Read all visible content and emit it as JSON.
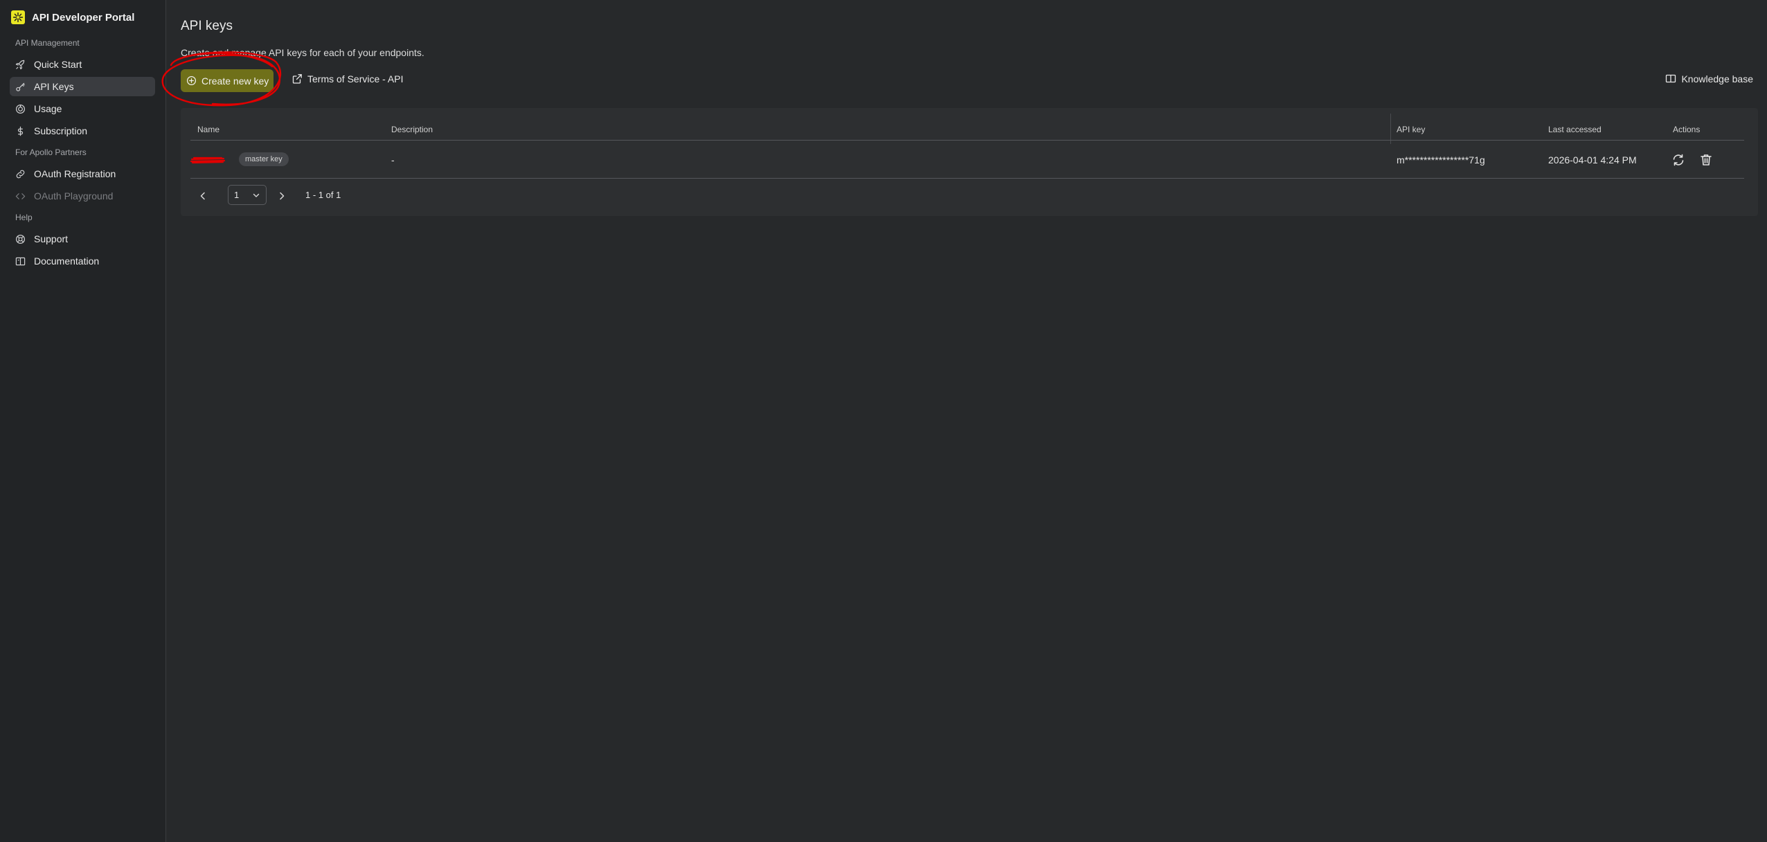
{
  "sidebar": {
    "brand_title": "API Developer Portal",
    "sections": [
      {
        "label": "API Management"
      },
      {
        "label": "For Apollo Partners"
      },
      {
        "label": "Help"
      }
    ],
    "items": [
      {
        "label": "Quick Start",
        "icon": "rocket-icon"
      },
      {
        "label": "API Keys",
        "icon": "key-icon",
        "active": true
      },
      {
        "label": "Usage",
        "icon": "gauge-icon"
      },
      {
        "label": "Subscription",
        "icon": "dollar-icon"
      },
      {
        "label": "OAuth Registration",
        "icon": "link-icon"
      },
      {
        "label": "OAuth Playground",
        "icon": "code-icon",
        "disabled": true
      },
      {
        "label": "Support",
        "icon": "support-icon"
      },
      {
        "label": "Documentation",
        "icon": "book-icon"
      }
    ]
  },
  "main": {
    "title": "API keys",
    "description": "Create and manage API keys for each of your endpoints.",
    "create_button": "Create new key",
    "tos_link": "Terms of Service - API",
    "kb_link": "Knowledge base",
    "table": {
      "headers": [
        "Name",
        "Description",
        "API key",
        "Last accessed",
        "Actions"
      ],
      "rows": [
        {
          "badge": "master key",
          "description": "-",
          "api_key": "m*****************71g",
          "last_accessed": "2026-04-01 4:24 PM"
        }
      ]
    },
    "pagination": {
      "page": "1",
      "info": "1 - 1 of 1"
    }
  },
  "colors": {
    "accent": "#6f7019",
    "brand_logo": "#e8e624",
    "annotation": "#e00000"
  }
}
